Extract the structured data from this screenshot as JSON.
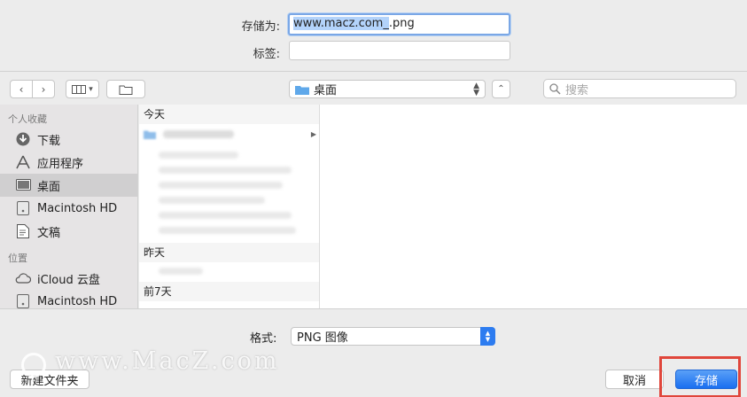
{
  "save": {
    "save_as_label": "存储为:",
    "filename_selected": "www.macz.com_",
    "filename_ext": ".png",
    "tags_label": "标签:",
    "tags_value": ""
  },
  "toolbar": {
    "location": "桌面",
    "search_placeholder": "搜索"
  },
  "sidebar": {
    "favorites_header": "个人收藏",
    "favorites": [
      {
        "label": "下载",
        "icon": "download-icon"
      },
      {
        "label": "应用程序",
        "icon": "applications-icon"
      },
      {
        "label": "桌面",
        "icon": "desktop-icon",
        "active": true
      },
      {
        "label": "Macintosh HD",
        "icon": "disk-icon"
      },
      {
        "label": "文稿",
        "icon": "documents-icon"
      }
    ],
    "locations_header": "位置",
    "locations": [
      {
        "label": "iCloud 云盘",
        "icon": "cloud-icon"
      },
      {
        "label": "Macintosh HD",
        "icon": "disk-icon"
      }
    ]
  },
  "browser": {
    "today_header": "今天",
    "yesterday_header": "昨天",
    "earlier_header": "前7天"
  },
  "bottom": {
    "format_label": "格式:",
    "format_value": "PNG 图像",
    "new_folder": "新建文件夹",
    "cancel": "取消",
    "save": "存储"
  },
  "watermark": "www.MacZ.com",
  "colors": {
    "accent": "#1a6ff0",
    "highlight_box": "#e0463b"
  }
}
